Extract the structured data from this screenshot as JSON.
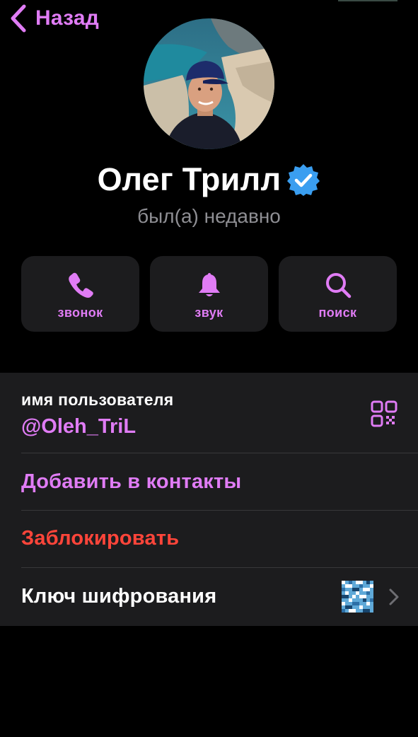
{
  "colors": {
    "accent": "#e07cf5",
    "danger": "#ff453a",
    "verified": "#3a9ef0",
    "secondary_text": "#8e8e93",
    "cell_bg": "#1c1c1e"
  },
  "nav": {
    "back_label": "Назад",
    "back_icon": "chevron-left-icon"
  },
  "profile": {
    "name": "Олег Трилл",
    "verified_icon": "verified-badge-icon",
    "status": "был(а) недавно"
  },
  "actions": [
    {
      "label": "звонок",
      "icon": "phone-icon"
    },
    {
      "label": "звук",
      "icon": "bell-icon"
    },
    {
      "label": "поиск",
      "icon": "search-icon"
    }
  ],
  "info": {
    "username_caption": "имя пользователя",
    "username_value": "@Oleh_TriL",
    "qr_icon": "qr-code-icon",
    "add_contact_label": "Добавить в контакты",
    "block_label": "Заблокировать",
    "encryption_key_label": "Ключ шифрования"
  }
}
